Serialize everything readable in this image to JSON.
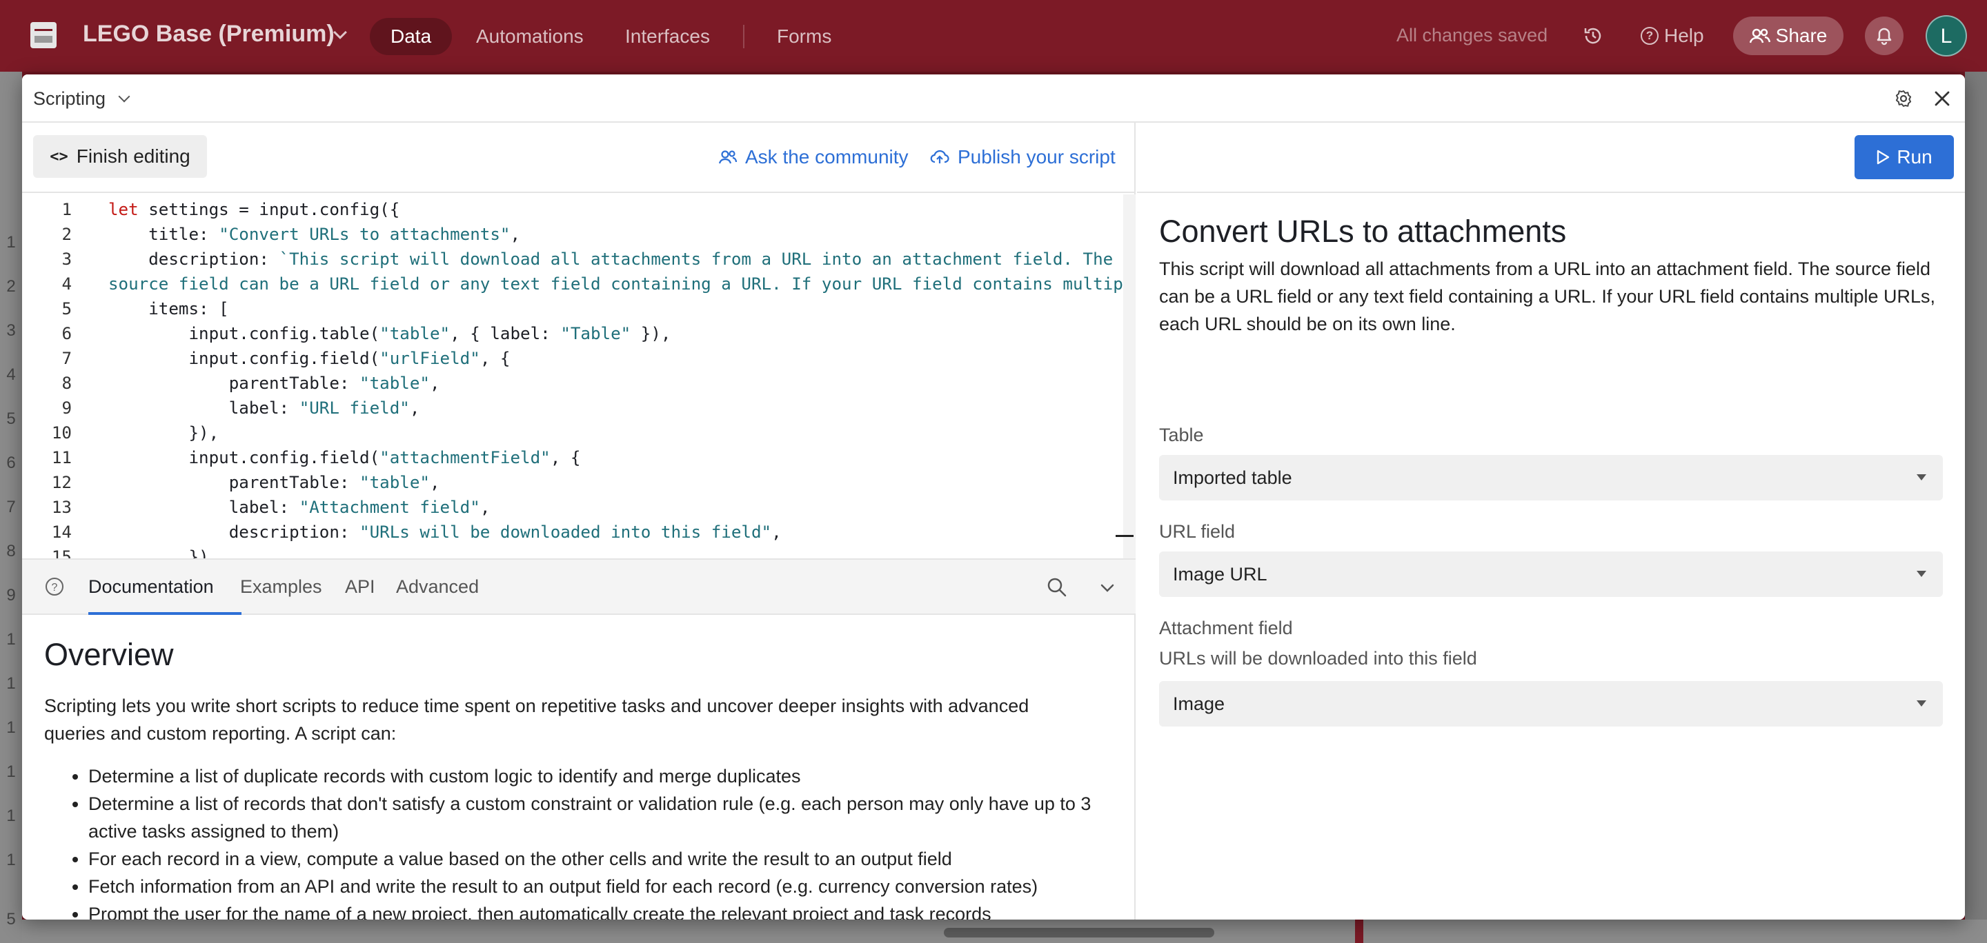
{
  "topbar": {
    "base_name": "LEGO Base (Premium)",
    "nav": [
      "Data",
      "Automations",
      "Interfaces",
      "Forms"
    ],
    "status": "All changes saved",
    "help_label": "Help",
    "share_label": "Share",
    "avatar_initial": "L"
  },
  "background": {
    "row_numbers": [
      "1",
      "2",
      "3",
      "4",
      "5",
      "6",
      "7",
      "8",
      "9",
      "1",
      "1",
      "1",
      "1",
      "1",
      "1",
      "5"
    ]
  },
  "modal": {
    "title": "Scripting",
    "toolbar": {
      "finish_label": "Finish editing",
      "ask_label": "Ask the community",
      "publish_label": "Publish your script"
    },
    "code_lines": [
      {
        "n": "1",
        "html": "<span class=\"tok-kw\">let</span> settings = input.config({"
      },
      {
        "n": "2",
        "html": "    title: <span class=\"tok-str\">\"Convert URLs to attachments\"</span>,"
      },
      {
        "n": "3",
        "html": "    description: <span class=\"tok-str\">`This script will download all attachments from a URL into an attachment field. The</span>"
      },
      {
        "n": "4",
        "html": "<span class=\"tok-str\">source field can be a URL field or any text field containing a URL. If your URL field contains multiple</span>"
      },
      {
        "n": "5",
        "html": "    items: ["
      },
      {
        "n": "6",
        "html": "        input.config.table(<span class=\"tok-str\">\"table\"</span>, { label: <span class=\"tok-str\">\"Table\"</span> }),"
      },
      {
        "n": "7",
        "html": "        input.config.field(<span class=\"tok-str\">\"urlField\"</span>, {"
      },
      {
        "n": "8",
        "html": "            parentTable: <span class=\"tok-str\">\"table\"</span>,"
      },
      {
        "n": "9",
        "html": "            label: <span class=\"tok-str\">\"URL field\"</span>,"
      },
      {
        "n": "10",
        "html": "        }),"
      },
      {
        "n": "11",
        "html": "        input.config.field(<span class=\"tok-str\">\"attachmentField\"</span>, {"
      },
      {
        "n": "12",
        "html": "            parentTable: <span class=\"tok-str\">\"table\"</span>,"
      },
      {
        "n": "13",
        "html": "            label: <span class=\"tok-str\">\"Attachment field\"</span>,"
      },
      {
        "n": "14",
        "html": "            description: <span class=\"tok-str\">\"URLs will be downloaded into this field\"</span>,"
      },
      {
        "n": "15",
        "html": "        }),"
      }
    ],
    "docs": {
      "tabs": [
        "Documentation",
        "Examples",
        "API",
        "Advanced"
      ],
      "heading": "Overview",
      "intro": "Scripting lets you write short scripts to reduce time spent on repetitive tasks and uncover deeper insights with advanced queries and custom reporting. A script can:",
      "bullets": [
        "Determine a list of duplicate records with custom logic to identify and merge duplicates",
        "Determine a list of records that don't satisfy a custom constraint or validation rule (e.g. each person may only have up to 3 active tasks assigned to them)",
        "For each record in a view, compute a value based on the other cells and write the result to an output field",
        "Fetch information from an API and write the result to an output field for each record (e.g. currency conversion rates)",
        "Prompt the user for the name of a new project, then automatically create the relevant project and task records"
      ]
    },
    "run_panel": {
      "run_label": "Run",
      "title": "Convert URLs to attachments",
      "description": "This script will download all attachments from a URL into an attachment field. The source field can be a URL field or any text field containing a URL. If your URL field contains multiple URLs, each URL should be on its own line.",
      "table_label": "Table",
      "table_value": "Imported table",
      "url_label": "URL field",
      "url_value": "Image URL",
      "attachment_label": "Attachment field",
      "attachment_sub": "URLs will be downloaded into this field",
      "attachment_value": "Image"
    }
  },
  "colors": {
    "brand_bar": "#7c1a26",
    "accent": "#2d6fd6",
    "keyword": "#c41a16",
    "string": "#1f6f7a"
  },
  "icons": {
    "top": [
      "logo-icon",
      "chevron-down-icon",
      "history-icon",
      "help-icon",
      "share-people-icon",
      "bell-icon"
    ],
    "modal": [
      "gear-icon",
      "close-icon",
      "code-icon",
      "community-icon",
      "publish-icon",
      "play-icon",
      "search-icon",
      "help-circle-icon",
      "chevron-down-icon"
    ]
  }
}
